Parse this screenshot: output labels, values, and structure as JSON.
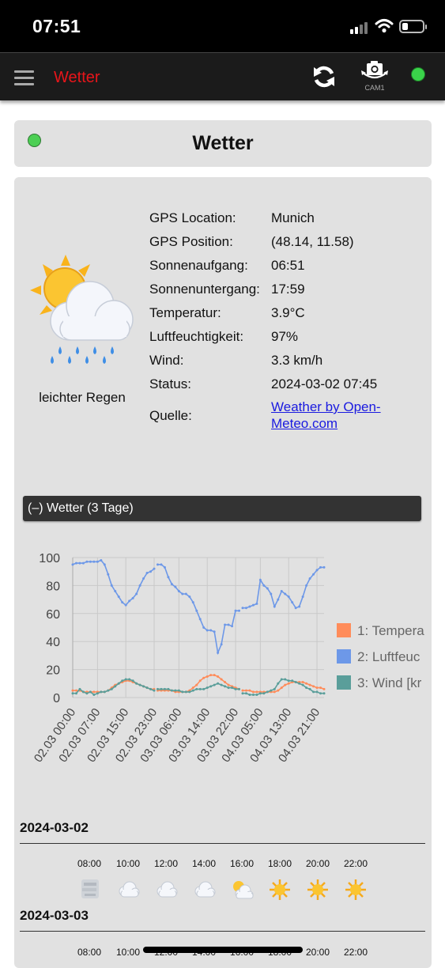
{
  "status_bar": {
    "time": "07:51"
  },
  "app_bar": {
    "title": "Wetter",
    "cam_label": "CAM1"
  },
  "colors": {
    "accent": "#e8151a",
    "online": "#3ad34a",
    "link": "#1a1ae0",
    "series": [
      "#ff8c5a",
      "#6d98e8",
      "#5a9e9a"
    ]
  },
  "header": {
    "title": "Wetter"
  },
  "current": {
    "condition": "leichter Regen",
    "icon": "sun-cloud-rain-icon",
    "rows": [
      {
        "label": "GPS Location:",
        "value": "Munich"
      },
      {
        "label": "GPS Position:",
        "value": "(48.14, 11.58)"
      },
      {
        "label": "Sonnenaufgang:",
        "value": "06:51"
      },
      {
        "label": "Sonnenuntergang:",
        "value": "17:59"
      },
      {
        "label": "Temperatur:",
        "value": "3.9°C"
      },
      {
        "label": "Luftfeuchtigkeit:",
        "value": "97%"
      },
      {
        "label": "Wind:",
        "value": "3.3 km/h"
      },
      {
        "label": "Status:",
        "value": "2024-03-02 07:45"
      }
    ],
    "source_label": "Quelle:",
    "source_link": "Weather by Open-Meteo.com"
  },
  "chart_section": {
    "title": "(–) Wetter (3 Tage)"
  },
  "chart_data": {
    "type": "line",
    "ylim": [
      0,
      100
    ],
    "yticks": [
      0,
      20,
      40,
      60,
      80,
      100
    ],
    "x_tick_labels": [
      "02.03 00:00",
      "02.03 07:00",
      "02.03 15:00",
      "02.03 23:00",
      "03.03 06:00",
      "03.03 14:00",
      "03.03 22:00",
      "04.03 05:00",
      "04.03 13:00",
      "04.03 21:00"
    ],
    "x_tick_hours": [
      0,
      7,
      15,
      23,
      30,
      38,
      46,
      53,
      61,
      69
    ],
    "x_range_hours": [
      0,
      71
    ],
    "legend": [
      "1: Tempera",
      "2: Luftfeuc",
      "3: Wind [kr"
    ],
    "legend_position": "right",
    "grid": true,
    "series": [
      {
        "name": "1: Tempera",
        "segments": [
          [
            [
              0,
              5
            ],
            [
              1,
              5
            ],
            [
              2,
              5
            ],
            [
              3,
              4
            ],
            [
              4,
              4
            ],
            [
              5,
              4
            ],
            [
              6,
              4
            ],
            [
              7,
              4
            ],
            [
              8,
              4
            ],
            [
              9,
              4
            ],
            [
              10,
              5
            ],
            [
              11,
              7
            ],
            [
              12,
              9
            ],
            [
              13,
              10
            ],
            [
              14,
              11
            ],
            [
              15,
              12
            ],
            [
              16,
              12
            ],
            [
              17,
              11
            ],
            [
              18,
              10
            ],
            [
              19,
              9
            ],
            [
              20,
              8
            ],
            [
              21,
              7
            ],
            [
              22,
              6
            ],
            [
              23,
              6
            ]
          ],
          [
            [
              24,
              5
            ],
            [
              25,
              5
            ],
            [
              26,
              5
            ],
            [
              27,
              5
            ],
            [
              28,
              5
            ],
            [
              29,
              4
            ],
            [
              30,
              4
            ],
            [
              31,
              4
            ],
            [
              32,
              4
            ],
            [
              33,
              5
            ],
            [
              34,
              7
            ],
            [
              35,
              9
            ],
            [
              36,
              12
            ],
            [
              37,
              14
            ],
            [
              38,
              15
            ],
            [
              39,
              16
            ],
            [
              40,
              16
            ],
            [
              41,
              15
            ],
            [
              42,
              13
            ],
            [
              43,
              11
            ],
            [
              44,
              9
            ],
            [
              45,
              8
            ],
            [
              46,
              7
            ],
            [
              47,
              6
            ]
          ],
          [
            [
              48,
              5
            ],
            [
              49,
              5
            ],
            [
              50,
              5
            ],
            [
              51,
              4
            ],
            [
              52,
              4
            ],
            [
              53,
              4
            ],
            [
              54,
              4
            ],
            [
              55,
              4
            ],
            [
              56,
              4
            ],
            [
              57,
              4
            ],
            [
              58,
              5
            ],
            [
              59,
              7
            ],
            [
              60,
              9
            ],
            [
              61,
              10
            ],
            [
              62,
              11
            ],
            [
              63,
              11
            ],
            [
              64,
              11
            ],
            [
              65,
              11
            ],
            [
              66,
              10
            ],
            [
              67,
              9
            ],
            [
              68,
              8
            ],
            [
              69,
              7
            ],
            [
              70,
              7
            ],
            [
              71,
              6
            ]
          ]
        ]
      },
      {
        "name": "2: Luftfeuc",
        "segments": [
          [
            [
              0,
              95
            ],
            [
              1,
              96
            ],
            [
              2,
              96
            ],
            [
              3,
              96
            ],
            [
              4,
              97
            ],
            [
              5,
              97
            ],
            [
              6,
              97
            ],
            [
              7,
              97
            ],
            [
              8,
              98
            ],
            [
              9,
              95
            ],
            [
              10,
              88
            ],
            [
              11,
              80
            ],
            [
              12,
              76
            ],
            [
              13,
              72
            ],
            [
              14,
              68
            ],
            [
              15,
              66
            ],
            [
              16,
              69
            ],
            [
              17,
              71
            ],
            [
              18,
              74
            ],
            [
              19,
              80
            ],
            [
              20,
              85
            ],
            [
              21,
              89
            ],
            [
              22,
              90
            ],
            [
              23,
              92
            ]
          ],
          [
            [
              24,
              95
            ],
            [
              25,
              95
            ],
            [
              26,
              93
            ],
            [
              27,
              86
            ],
            [
              28,
              81
            ],
            [
              29,
              79
            ],
            [
              30,
              76
            ],
            [
              31,
              74
            ],
            [
              32,
              74
            ],
            [
              33,
              72
            ],
            [
              34,
              68
            ],
            [
              35,
              62
            ],
            [
              36,
              56
            ],
            [
              37,
              50
            ],
            [
              38,
              48
            ],
            [
              39,
              48
            ],
            [
              40,
              47
            ],
            [
              41,
              32
            ],
            [
              42,
              38
            ],
            [
              43,
              52
            ],
            [
              44,
              52
            ],
            [
              45,
              51
            ],
            [
              46,
              62
            ],
            [
              47,
              62
            ]
          ],
          [
            [
              48,
              64
            ],
            [
              49,
              64
            ],
            [
              50,
              65
            ],
            [
              51,
              66
            ],
            [
              52,
              67
            ],
            [
              53,
              84
            ],
            [
              54,
              80
            ],
            [
              55,
              78
            ],
            [
              56,
              74
            ],
            [
              57,
              65
            ],
            [
              58,
              70
            ],
            [
              59,
              76
            ],
            [
              60,
              74
            ],
            [
              61,
              72
            ],
            [
              62,
              68
            ],
            [
              63,
              64
            ],
            [
              64,
              65
            ],
            [
              65,
              72
            ],
            [
              66,
              80
            ],
            [
              67,
              85
            ],
            [
              68,
              88
            ],
            [
              69,
              91
            ],
            [
              70,
              93
            ],
            [
              71,
              93
            ]
          ]
        ]
      },
      {
        "name": "3: Wind [kr",
        "segments": [
          [
            [
              0,
              3
            ],
            [
              1,
              3
            ],
            [
              2,
              6
            ],
            [
              3,
              4
            ],
            [
              4,
              3
            ],
            [
              5,
              4
            ],
            [
              6,
              2
            ],
            [
              7,
              3
            ],
            [
              8,
              4
            ],
            [
              9,
              4
            ],
            [
              10,
              5
            ],
            [
              11,
              6
            ],
            [
              12,
              8
            ],
            [
              13,
              10
            ],
            [
              14,
              12
            ],
            [
              15,
              13
            ],
            [
              16,
              13
            ],
            [
              17,
              12
            ],
            [
              18,
              10
            ],
            [
              19,
              9
            ],
            [
              20,
              8
            ],
            [
              21,
              7
            ],
            [
              22,
              6
            ],
            [
              23,
              5
            ]
          ],
          [
            [
              24,
              6
            ],
            [
              25,
              6
            ],
            [
              26,
              6
            ],
            [
              27,
              6
            ],
            [
              28,
              5
            ],
            [
              29,
              5
            ],
            [
              30,
              5
            ],
            [
              31,
              4
            ],
            [
              32,
              4
            ],
            [
              33,
              4
            ],
            [
              34,
              5
            ],
            [
              35,
              6
            ],
            [
              36,
              6
            ],
            [
              37,
              6
            ],
            [
              38,
              7
            ],
            [
              39,
              8
            ],
            [
              40,
              9
            ],
            [
              41,
              10
            ],
            [
              42,
              9
            ],
            [
              43,
              8
            ],
            [
              44,
              7
            ],
            [
              45,
              7
            ],
            [
              46,
              6
            ],
            [
              47,
              6
            ]
          ],
          [
            [
              48,
              3
            ],
            [
              49,
              3
            ],
            [
              50,
              2
            ],
            [
              51,
              2
            ],
            [
              52,
              2
            ],
            [
              53,
              3
            ],
            [
              54,
              3
            ],
            [
              55,
              4
            ],
            [
              56,
              5
            ],
            [
              57,
              6
            ],
            [
              58,
              10
            ],
            [
              59,
              13
            ],
            [
              60,
              13
            ],
            [
              61,
              12
            ],
            [
              62,
              12
            ],
            [
              63,
              11
            ],
            [
              64,
              10
            ],
            [
              65,
              9
            ],
            [
              66,
              7
            ],
            [
              67,
              6
            ],
            [
              68,
              4
            ],
            [
              69,
              4
            ],
            [
              70,
              3
            ],
            [
              71,
              3
            ]
          ]
        ]
      }
    ]
  },
  "forecast": [
    {
      "date": "2024-03-02",
      "hours": [
        {
          "time": "08:00",
          "icon": "fog-icon"
        },
        {
          "time": "10:00",
          "icon": "cloud-icon"
        },
        {
          "time": "12:00",
          "icon": "cloud-icon"
        },
        {
          "time": "14:00",
          "icon": "cloud-icon"
        },
        {
          "time": "16:00",
          "icon": "sun-behind-cloud-icon"
        },
        {
          "time": "18:00",
          "icon": "sun-icon"
        },
        {
          "time": "20:00",
          "icon": "sun-icon"
        },
        {
          "time": "22:00",
          "icon": "sun-icon"
        }
      ]
    },
    {
      "date": "2024-03-03",
      "hours": [
        {
          "time": "08:00"
        },
        {
          "time": "10:00"
        },
        {
          "time": "12:00"
        },
        {
          "time": "14:00"
        },
        {
          "time": "16:00"
        },
        {
          "time": "18:00"
        },
        {
          "time": "20:00"
        },
        {
          "time": "22:00"
        }
      ]
    }
  ]
}
